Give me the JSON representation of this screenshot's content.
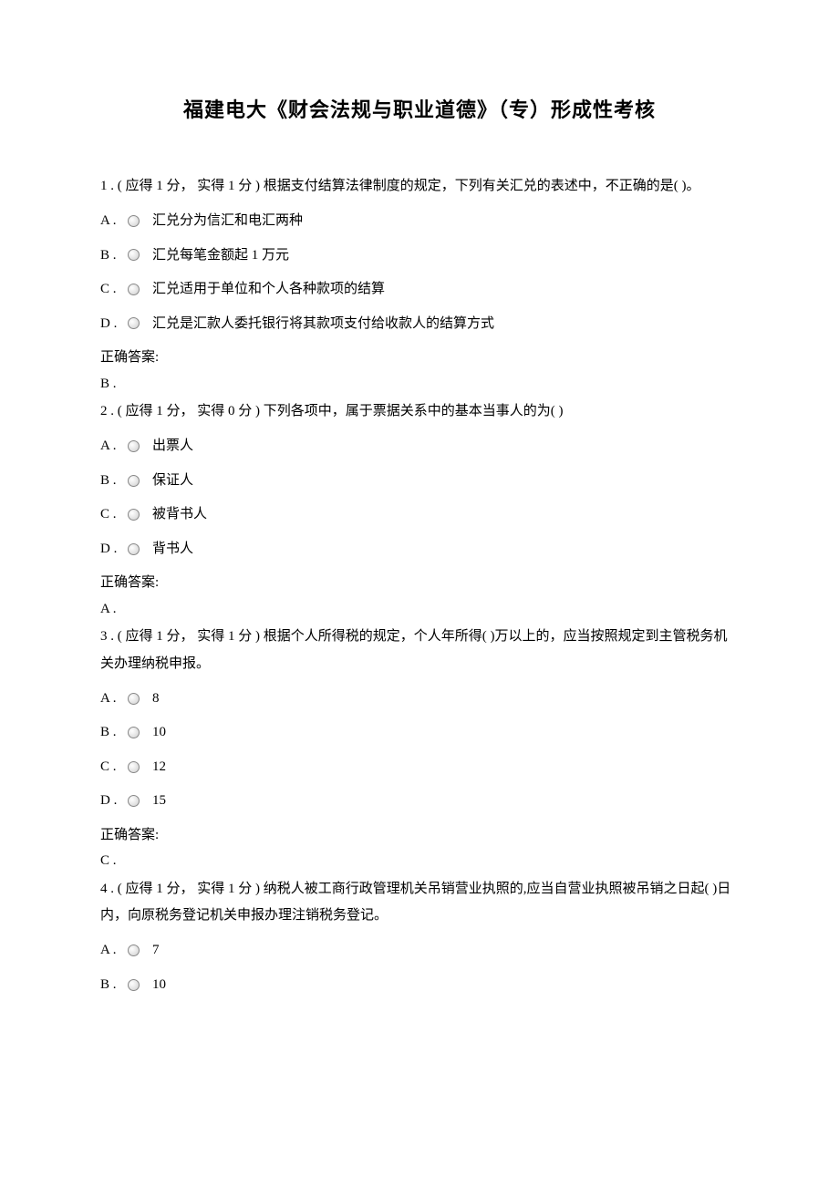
{
  "title": "福建电大《财会法规与职业道德》（专）形成性考核",
  "questions": [
    {
      "num": "1",
      "score_text": "( 应得  1  分，  实得  1 分  )",
      "stem": "根据支付结算法律制度的规定，下列有关汇兑的表述中，不正确的是(        )。",
      "options": [
        {
          "label": "A .",
          "text": "汇兑分为信汇和电汇两种"
        },
        {
          "label": "B .",
          "text": "汇兑每笔金额起 1 万元"
        },
        {
          "label": "C .",
          "text": "汇兑适用于单位和个人各种款项的结算"
        },
        {
          "label": "D .",
          "text": "汇兑是汇款人委托银行将其款项支付给收款人的结算方式"
        }
      ],
      "answer_label": "正确答案:",
      "answer": "B ."
    },
    {
      "num": "2",
      "score_text": "( 应得  1  分，  实得  0 分  )",
      "stem": "下列各项中，属于票据关系中的基本当事人的为(          )",
      "options": [
        {
          "label": "A .",
          "text": "出票人"
        },
        {
          "label": "B .",
          "text": "保证人"
        },
        {
          "label": "C .",
          "text": "被背书人"
        },
        {
          "label": "D .",
          "text": "背书人"
        }
      ],
      "answer_label": "正确答案:",
      "answer": "A ."
    },
    {
      "num": "3",
      "score_text": "( 应得  1  分，  实得  1 分  )",
      "stem": "根据个人所得税的规定，个人年所得(    )万以上的，应当按照规定到主管税务机关办理纳税申报。",
      "options": [
        {
          "label": "A .",
          "text": "8"
        },
        {
          "label": "B .",
          "text": "10"
        },
        {
          "label": "C .",
          "text": "12"
        },
        {
          "label": "D .",
          "text": "15"
        }
      ],
      "answer_label": "正确答案:",
      "answer": "C ."
    },
    {
      "num": "4",
      "score_text": "( 应得  1  分，  实得  1 分  )",
      "stem": "纳税人被工商行政管理机关吊销营业执照的,应当自营业执照被吊销之日起(         )日内，向原税务登记机关申报办理注销税务登记。",
      "options": [
        {
          "label": "A .",
          "text": "7"
        },
        {
          "label": "B .",
          "text": "10"
        }
      ],
      "answer_label": "",
      "answer": ""
    }
  ]
}
